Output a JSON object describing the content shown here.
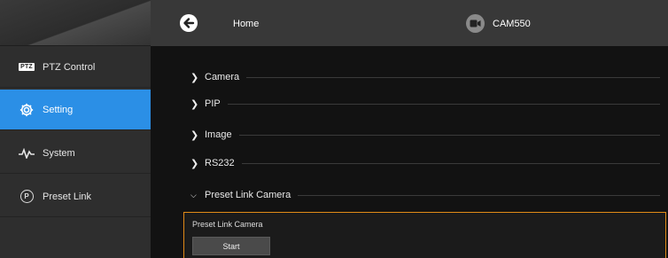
{
  "header": {
    "home_label": "Home",
    "camera_label": "CAM550"
  },
  "sidebar": {
    "items": [
      {
        "label": "PTZ Control",
        "icon": "ptz-icon",
        "badge": "PTZ",
        "active": false
      },
      {
        "label": "Setting",
        "icon": "gear-icon",
        "active": true
      },
      {
        "label": "System",
        "icon": "pulse-icon",
        "active": false
      },
      {
        "label": "Preset Link",
        "icon": "preset-link-icon",
        "badge": "P",
        "active": false
      }
    ]
  },
  "main": {
    "sections": [
      {
        "label": "Camera",
        "expanded": false
      },
      {
        "label": "PIP",
        "expanded": false
      },
      {
        "label": "Image",
        "expanded": false
      },
      {
        "label": "RS232",
        "expanded": false
      },
      {
        "label": "Preset Link Camera",
        "expanded": true
      }
    ],
    "panel": {
      "title": "Preset Link Camera",
      "start_label": "Start"
    }
  },
  "colors": {
    "accent": "#2b8fe6",
    "panel_border": "#e08a17"
  }
}
